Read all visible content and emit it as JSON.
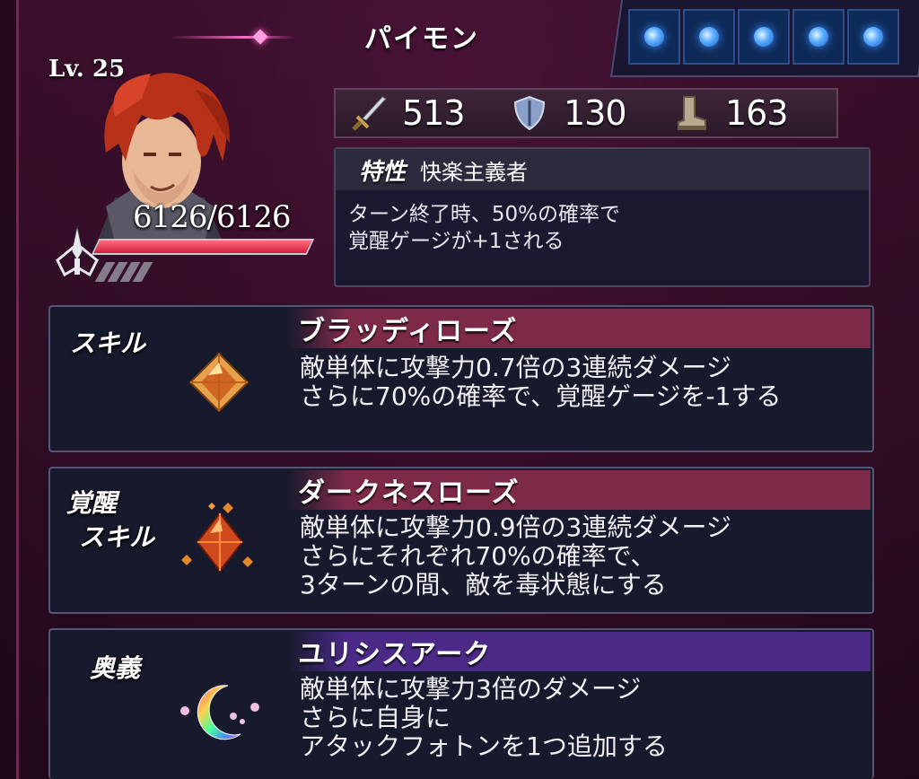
{
  "character": {
    "name": "パイモン",
    "level": "Lv. 25",
    "hp": "6126/6126",
    "hp_ratio": 1.0
  },
  "orb_slots": {
    "count": 5,
    "filled": 5,
    "color": "#3a8fff"
  },
  "stats": {
    "attack": "513",
    "defense": "130",
    "speed": "163",
    "icons": [
      "sword-icon",
      "shield-icon",
      "boot-icon"
    ]
  },
  "trait": {
    "tag": "特性",
    "name": "快楽主義者",
    "desc_lines": [
      "ターン終了時、50%の確率で",
      "覚醒ゲージが+1される"
    ]
  },
  "skills": [
    {
      "label_lines": [
        "スキル"
      ],
      "name": "ブラッディローズ",
      "desc_lines": [
        "敵単体に攻撃力0.7倍の3連続ダメージ",
        "さらに70%の確率で、覚醒ゲージを-1する"
      ],
      "icon": "orange-crystal-icon",
      "header_color": "#7d2a48"
    },
    {
      "label_lines": [
        "覚醒",
        "スキル"
      ],
      "name": "ダークネスローズ",
      "desc_lines": [
        "敵単体に攻撃力0.9倍の3連続ダメージ",
        "さらにそれぞれ70%の確率で、",
        "3ターンの間、敵を毒状態にする"
      ],
      "icon": "red-crystal-cluster-icon",
      "header_color": "#7d2a48"
    },
    {
      "label_lines": [
        "奥義"
      ],
      "name": "ユリシスアーク",
      "desc_lines": [
        "敵単体に攻撃力3倍のダメージ",
        "さらに自身に",
        "アタックフォトンを1つ追加する"
      ],
      "icon": "rainbow-crescent-icon",
      "header_color": "#4a2a86"
    }
  ]
}
